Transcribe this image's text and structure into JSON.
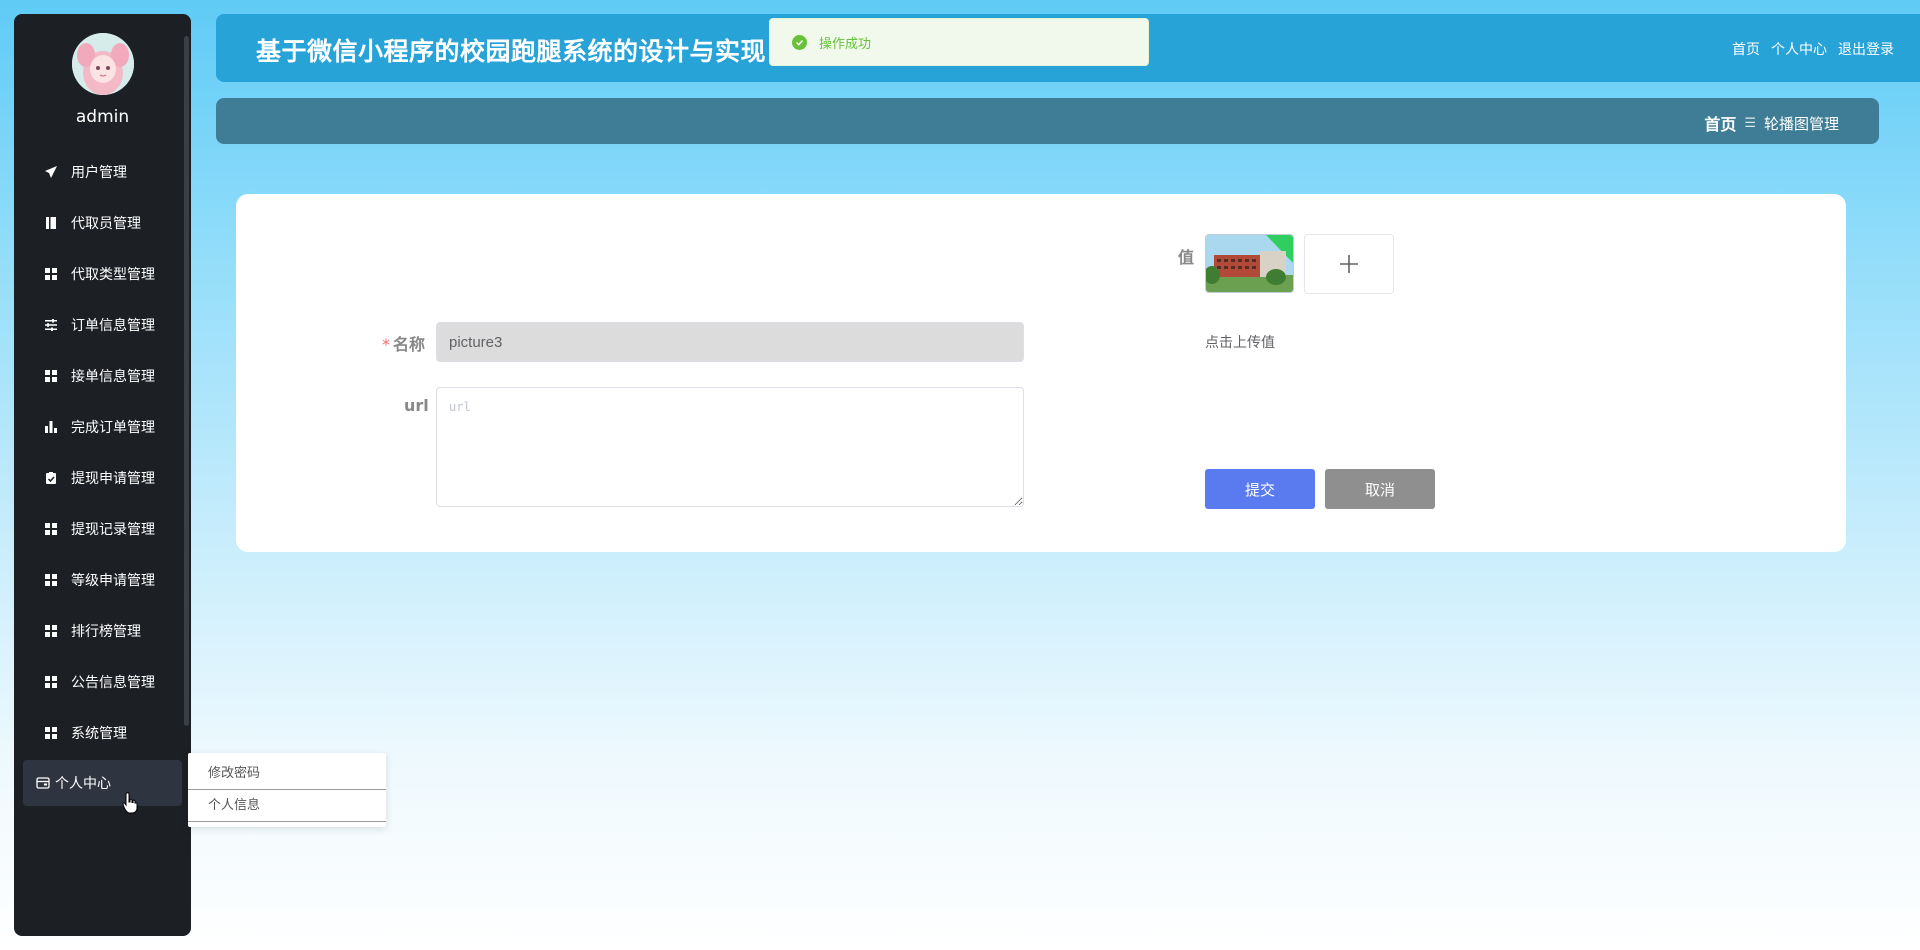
{
  "sidebar": {
    "username": "admin",
    "menu": [
      {
        "label": "用户管理",
        "icon": "send-icon"
      },
      {
        "label": "代取员管理",
        "icon": "book-icon"
      },
      {
        "label": "代取类型管理",
        "icon": "grid-icon"
      },
      {
        "label": "订单信息管理",
        "icon": "sliders-icon"
      },
      {
        "label": "接单信息管理",
        "icon": "grid-icon"
      },
      {
        "label": "完成订单管理",
        "icon": "bar-chart-icon"
      },
      {
        "label": "提现申请管理",
        "icon": "clipboard-check-icon"
      },
      {
        "label": "提现记录管理",
        "icon": "grid-icon"
      },
      {
        "label": "等级申请管理",
        "icon": "grid-icon"
      },
      {
        "label": "排行榜管理",
        "icon": "grid-icon"
      },
      {
        "label": "公告信息管理",
        "icon": "grid-icon"
      },
      {
        "label": "系统管理",
        "icon": "grid-icon"
      }
    ],
    "active_item": {
      "label": "个人中心",
      "icon": "wallet-icon"
    }
  },
  "dropdown": {
    "items": [
      "修改密码",
      "个人信息"
    ]
  },
  "header": {
    "title": "基于微信小程序的校园跑腿系统的设计与实现",
    "links": [
      "首页",
      "个人中心",
      "退出登录"
    ]
  },
  "toast": {
    "message": "操作成功"
  },
  "breadcrumb": {
    "home": "首页",
    "separator": "☰",
    "current": "轮播图管理"
  },
  "form": {
    "name_label": "名称",
    "required_mark": "*",
    "name_value": "picture3",
    "url_label": "url",
    "url_placeholder": "url",
    "value_label": "值",
    "upload_hint": "点击上传值",
    "upload_plus": "+",
    "submit_label": "提交",
    "cancel_label": "取消"
  },
  "colors": {
    "sidebar_bg": "#1c1f24",
    "header_bg": "#27a3d8",
    "breadcrumb_bg": "#3e7d95",
    "submit_bg": "#5a7bef",
    "cancel_bg": "#8f8f8f",
    "success": "#67c23a"
  }
}
